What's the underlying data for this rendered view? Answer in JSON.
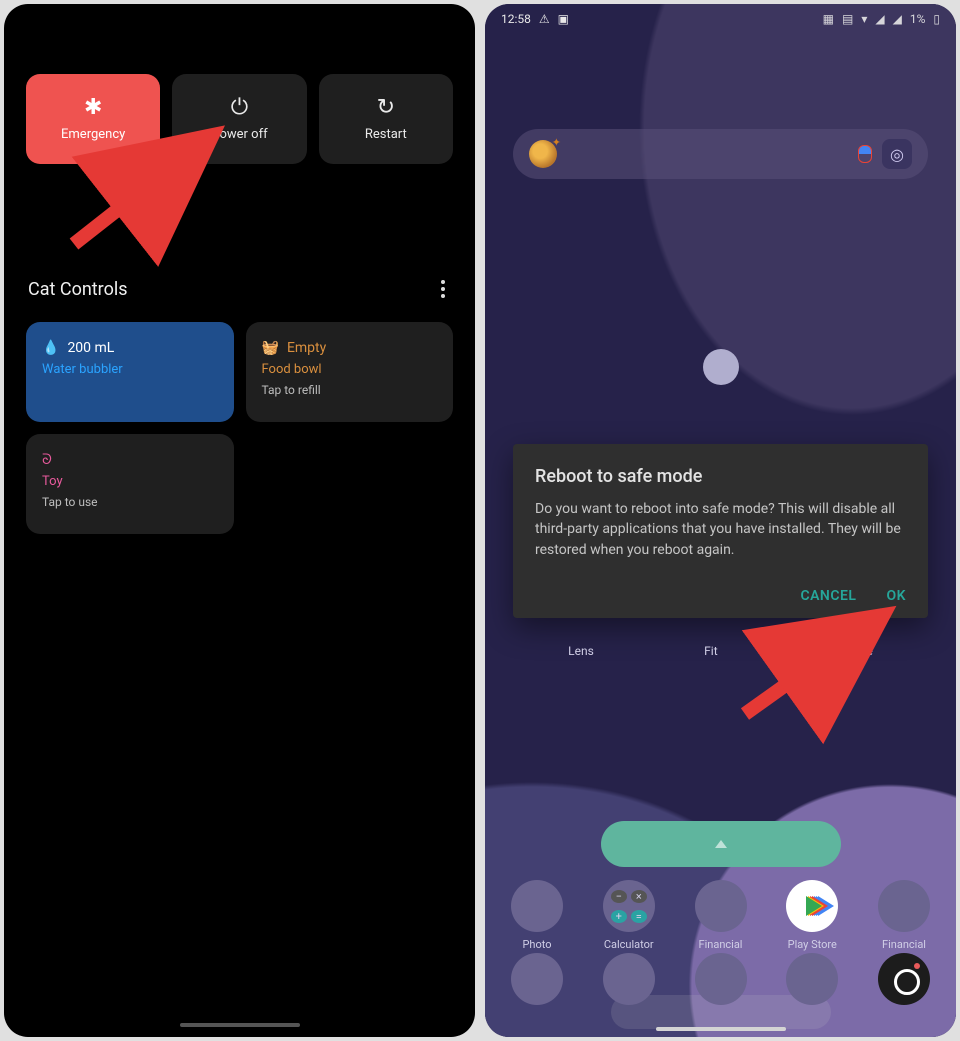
{
  "left": {
    "power_buttons": {
      "emergency": "Emergency",
      "power_off": "Power off",
      "restart": "Restart"
    },
    "controls_title": "Cat Controls",
    "cards": {
      "water": {
        "value": "200 mL",
        "name": "Water bubbler"
      },
      "food": {
        "value": "Empty",
        "name": "Food bowl",
        "sub": "Tap to refill"
      },
      "toy": {
        "name": "Toy",
        "sub": "Tap to use"
      }
    }
  },
  "right": {
    "status": {
      "time": "12:58",
      "battery": "1%"
    },
    "dialog": {
      "title": "Reboot to safe mode",
      "body": "Do you want to reboot into safe mode? This will disable all third-party applications that you have installed. They will be restored when you reboot again.",
      "cancel": "CANCEL",
      "ok": "OK"
    },
    "folder_labels": [
      "Lens",
      "Fit",
      "Lifestyle"
    ],
    "dock1": [
      "Photo",
      "Calculator",
      "Financial",
      "Play Store",
      "Financial"
    ]
  }
}
